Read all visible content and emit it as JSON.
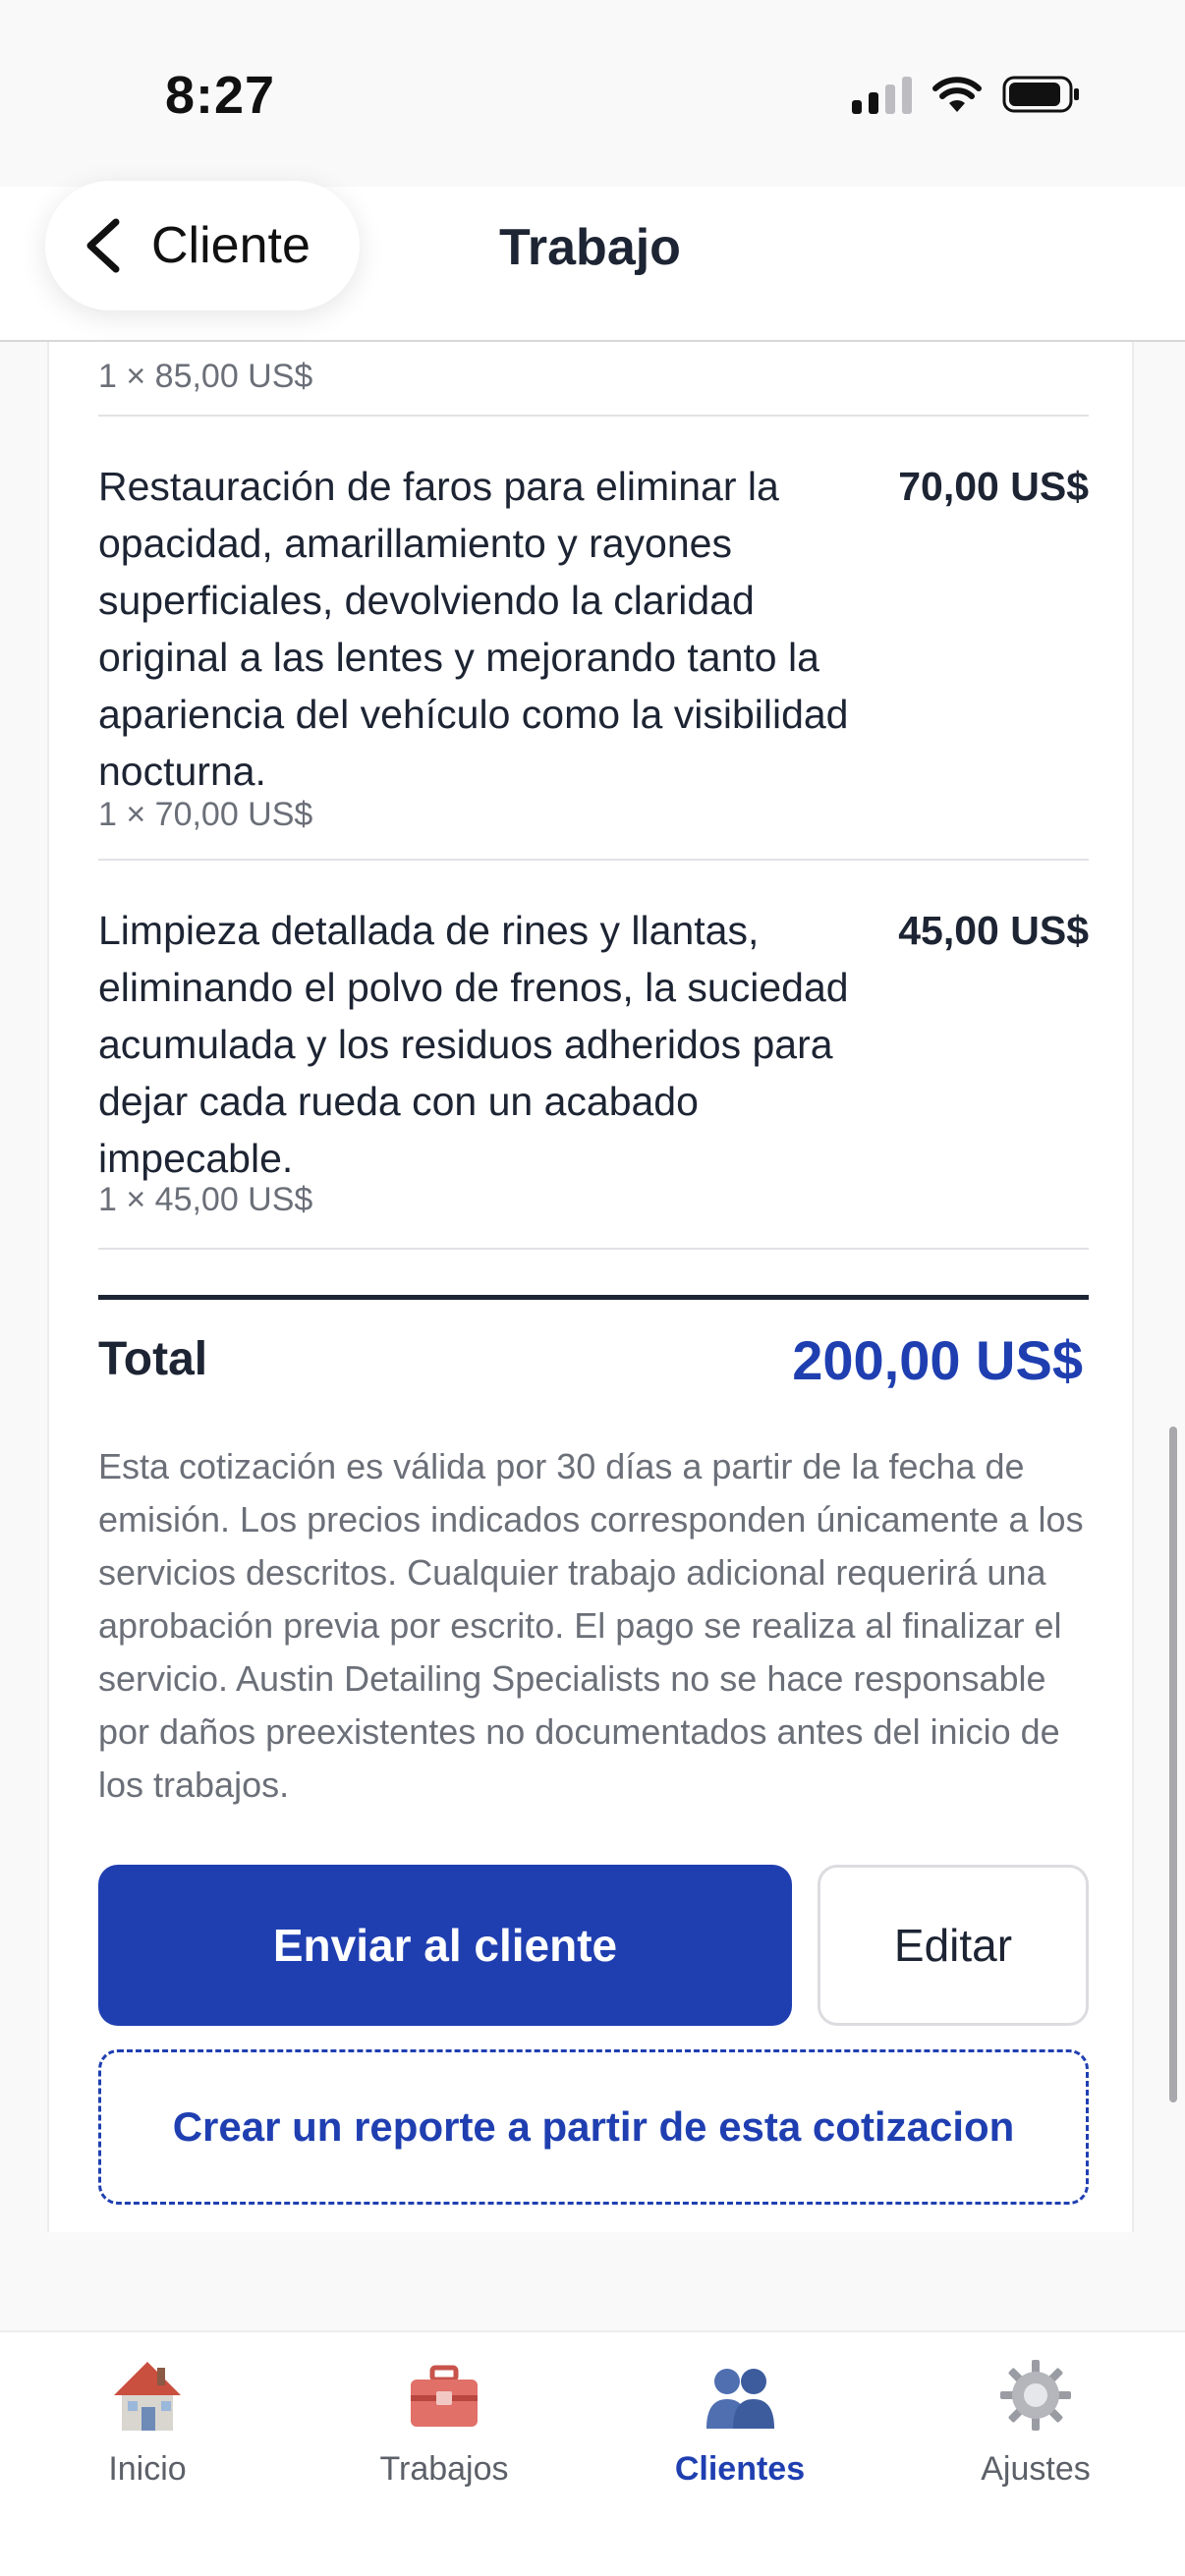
{
  "status_bar": {
    "time": "8:27",
    "icons": [
      "cellular-signal-icon",
      "wifi-icon",
      "battery-icon"
    ]
  },
  "nav": {
    "back_label": "Cliente",
    "title": "Trabajo"
  },
  "line_items": [
    {
      "description": "",
      "price": "",
      "qty_text": "1 × 85,00 US$"
    },
    {
      "description": "Restauración de faros para eliminar la opacidad, amarillamiento y rayones superficiales, devolviendo la claridad original a las lentes y mejorando tanto la apariencia del vehículo como la visibilidad nocturna.",
      "price": "70,00 US$",
      "qty_text": "1 × 70,00 US$"
    },
    {
      "description": "Limpieza detallada de rines y llantas, eliminando el polvo de frenos, la suciedad acumulada y los residuos adheridos para dejar cada rueda con un acabado impecable.",
      "price": "45,00 US$",
      "qty_text": "1 × 45,00 US$"
    }
  ],
  "total": {
    "label": "Total",
    "value": "200,00 US$"
  },
  "terms": "Esta cotización es válida por 30 días a partir de la fecha de emisión. Los precios indicados corresponden únicamente a los servicios descritos. Cualquier trabajo adicional requerirá una aprobación previa por escrito. El pago se realiza al finalizar el servicio. Austin Detailing Specialists no se hace responsable por daños preexistentes no documentados antes del inicio de los trabajos.",
  "actions": {
    "send_label": "Enviar al cliente",
    "edit_label": "Editar",
    "create_report_label": "Crear un reporte a partir de esta cotizacion"
  },
  "tabs": [
    {
      "label": "Inicio",
      "icon": "house-icon",
      "active": false
    },
    {
      "label": "Trabajos",
      "icon": "toolbox-icon",
      "active": false
    },
    {
      "label": "Clientes",
      "icon": "people-icon",
      "active": true
    },
    {
      "label": "Ajustes",
      "icon": "gear-icon",
      "active": false
    }
  ],
  "colors": {
    "accent": "#1f3fb1",
    "text": "#1d2433",
    "muted": "#6b6f78"
  }
}
